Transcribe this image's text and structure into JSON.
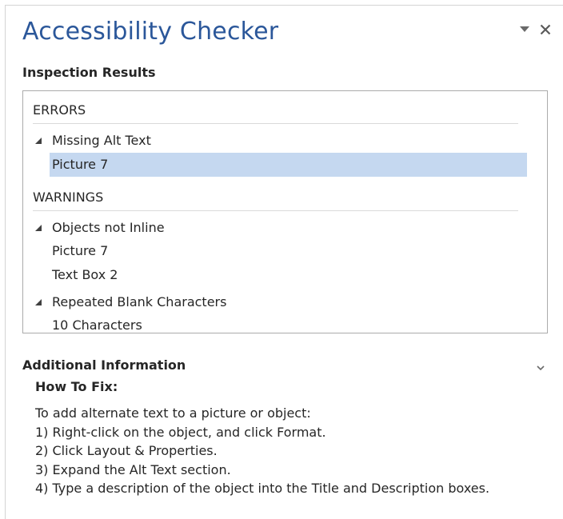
{
  "pane": {
    "title": "Accessibility Checker",
    "menu_icon": "dropdown-triangle-icon",
    "close_icon": "close-icon"
  },
  "inspection": {
    "label": "Inspection Results",
    "errors_header": "ERRORS",
    "errors": [
      {
        "issue": "Missing Alt Text",
        "items": [
          "Picture 7"
        ]
      }
    ],
    "warnings_header": "WARNINGS",
    "warnings": [
      {
        "issue": "Objects not Inline",
        "items": [
          "Picture 7",
          "Text Box 2"
        ]
      },
      {
        "issue": "Repeated Blank Characters",
        "items": [
          "10 Characters"
        ]
      }
    ],
    "selected_item": "Picture 7"
  },
  "info": {
    "label": "Additional Information",
    "toggle_icon": "chevron-down-icon",
    "how_to_fix_label": "How To Fix:",
    "lines": [
      "To add alternate text to a picture or object:",
      "1) Right-click on the object, and click Format.",
      "2) Click Layout & Properties.",
      "3) Expand the Alt Text section.",
      "4) Type a description of the object into the Title and Description boxes."
    ]
  },
  "colors": {
    "title": "#2b579a",
    "selection": "#c5d8f0",
    "text": "#262626"
  }
}
